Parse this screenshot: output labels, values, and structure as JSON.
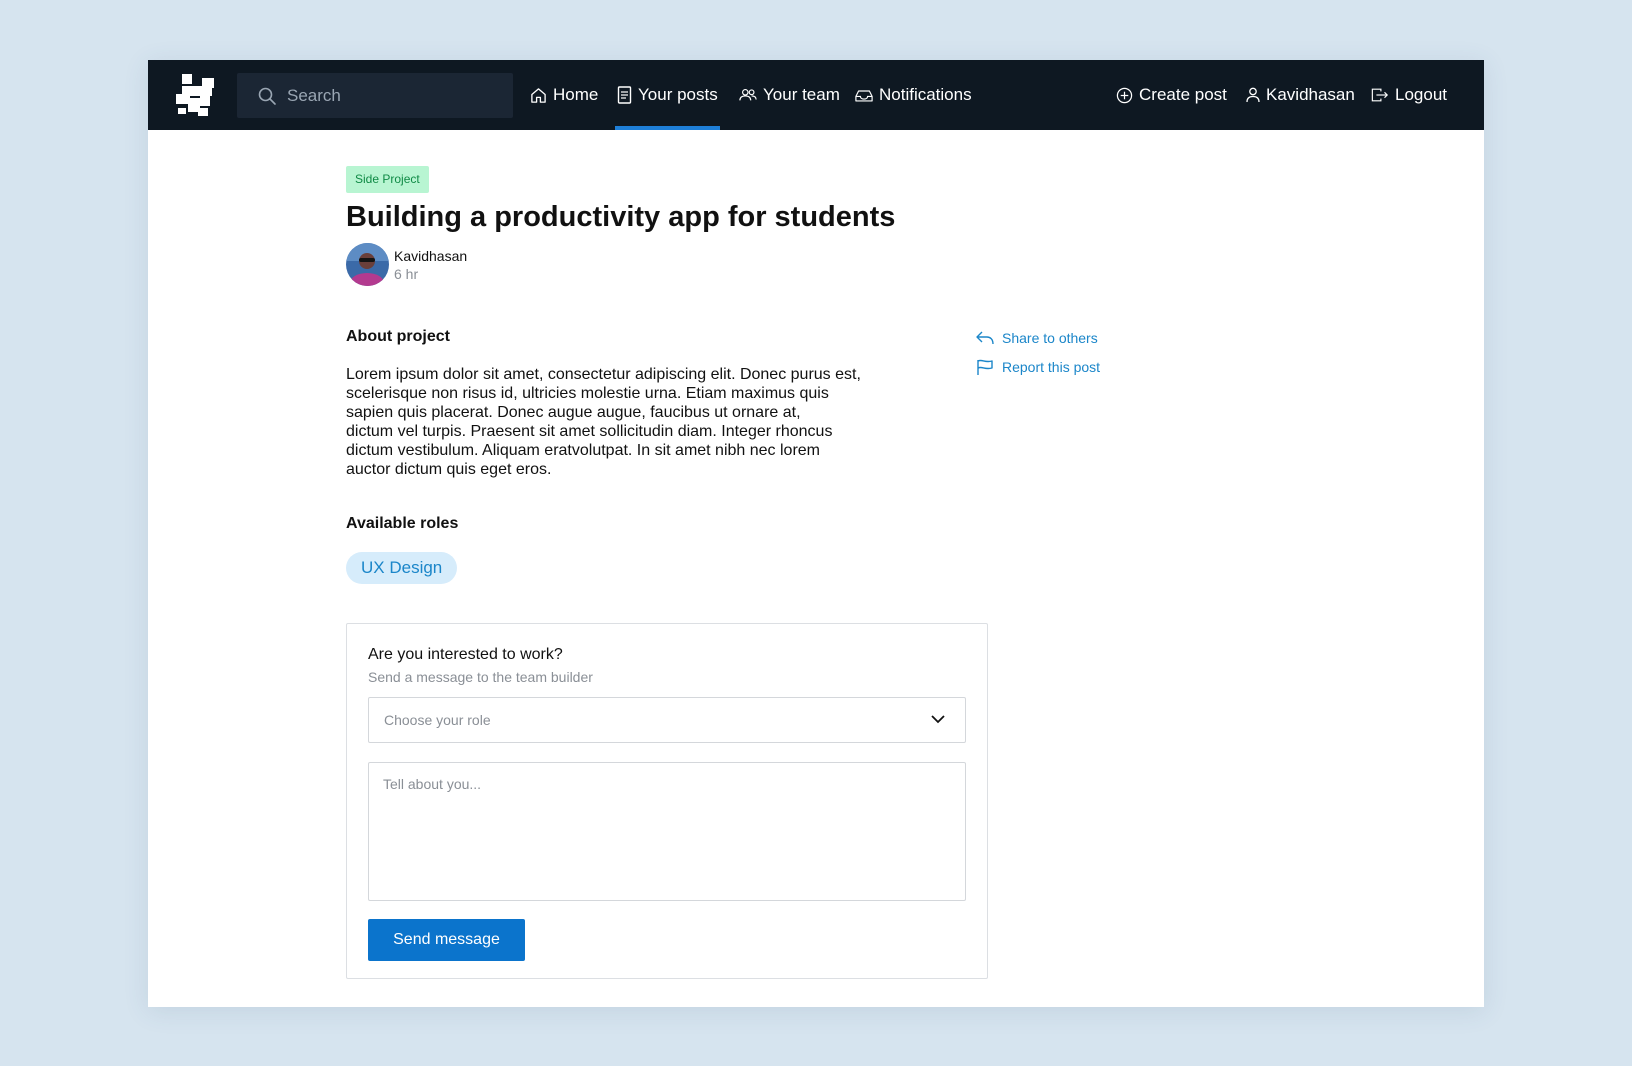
{
  "navbar": {
    "search_placeholder": "Search",
    "items": [
      {
        "label": "Home",
        "icon": "home-icon",
        "active": false
      },
      {
        "label": "Your posts",
        "icon": "document-icon",
        "active": true
      },
      {
        "label": "Your team",
        "icon": "team-icon",
        "active": false
      },
      {
        "label": "Notifications",
        "icon": "inbox-icon",
        "active": false
      }
    ],
    "right_items": [
      {
        "label": "Create post",
        "icon": "plus-circle-icon"
      },
      {
        "label": "Kavidhasan",
        "icon": "user-icon"
      },
      {
        "label": "Logout",
        "icon": "logout-icon"
      }
    ]
  },
  "post": {
    "tag": "Side Project",
    "title": "Building a productivity app for students",
    "author": "Kavidhasan",
    "time": "6 hr",
    "about_heading": "About project",
    "description": "Lorem ipsum dolor sit amet, consectetur adipiscing elit. Donec purus est,\nscelerisque non risus id, ultricies  molestie urna. Etiam maximus quis\nsapien quis placerat. Donec augue augue, faucibus ut ornare at,\ndictum vel turpis. Praesent sit amet sollicitudin diam. Integer rhoncus\ndictum vestibulum. Aliquam eratvolutpat. In sit amet nibh nec lorem\nauctor dictum quis eget eros.",
    "roles_heading": "Available roles",
    "roles": [
      "UX Design"
    ]
  },
  "side_actions": {
    "share_label": "Share to others",
    "report_label": "Report this post"
  },
  "apply_form": {
    "title": "Are you interested to work?",
    "subtitle": "Send a message to the team builder",
    "role_select_placeholder": "Choose your role",
    "message_placeholder": "Tell about you...",
    "send_label": "Send message"
  },
  "colors": {
    "nav_bg": "#0e1822",
    "accent": "#0b74cc",
    "link": "#1b86c9",
    "tag_bg": "#b8f5d2",
    "tag_text": "#0f8a45",
    "page_bg": "#d6e4ef"
  }
}
